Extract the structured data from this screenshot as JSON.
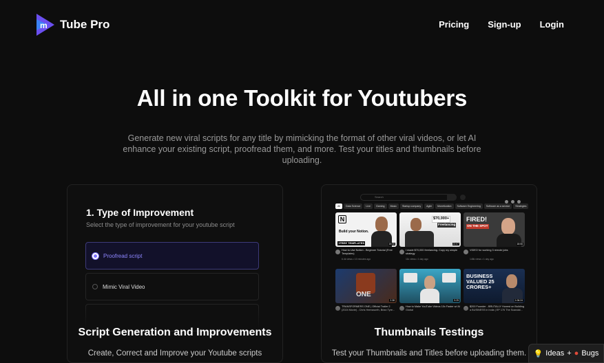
{
  "brand": {
    "name": "Tube Pro",
    "colors": {
      "logo_primary": "#6a4ff0",
      "logo_secondary": "#3b82f6"
    }
  },
  "nav": {
    "links": [
      "Pricing",
      "Sign-up",
      "Login"
    ]
  },
  "hero": {
    "title": "All in one Toolkit for Youtubers",
    "subtitle": "Generate new viral scripts for any title by mimicking the format of other viral videos, or let AI enhance your existing script, proofread them, and more. Test your titles and thumbnails before uploading."
  },
  "left_card": {
    "step_title": "1. Type of Improvement",
    "step_subtitle": "Select the type of improvement for your youtube script",
    "options": [
      {
        "label": "Proofread script",
        "selected": true
      },
      {
        "label": "Mimic Viral Video",
        "selected": false
      },
      {
        "label": "",
        "selected": false
      }
    ],
    "heading": "Script Generation and Improvements",
    "description": "Create, Correct and Improve your Youtube scripts"
  },
  "right_card": {
    "heading": "Thumbnails Testings",
    "description": "Test your Thumbnails and Titles before uploading them.",
    "yt": {
      "search_placeholder": "Search",
      "chips": [
        "All",
        "Data Science",
        "Live",
        "Gaming",
        "Music",
        "Startup company",
        "Agile",
        "Monetization",
        "Software Engineering",
        "Software as a service",
        "Strategies",
        "Ch"
      ],
      "videos": [
        {
          "title": "How to Use Notion - Beginner Tutorial (Free Templates)",
          "meta": "6.4k views • 10 minutes ago",
          "duration": "15:08",
          "thumb_text": "Build your Notion.",
          "thumb_badge": "+FREE TEMPLATES"
        },
        {
          "title": "I made $70,000 freelancing. Copy my simple strategy",
          "meta": "11k views • 1 day ago",
          "duration": "22:07",
          "thumb_text": "$70,000+",
          "thumb_badge": "Freelancing"
        },
        {
          "title": "VIDEO for working 3 remote jobs",
          "meta": "148k views • 1 day ago",
          "duration": "18:06",
          "thumb_text": "FIRED!",
          "thumb_badge": "ON THE SPOT"
        },
        {
          "title": "TRANSFORMERS ONE | Official Trailer 2 (2024 Movie) - Chris Hemsworth, Brian Tyre...",
          "meta": "",
          "duration": "2:38",
          "thumb_text": "ONE",
          "thumb_badge": ""
        },
        {
          "title": "How to Make YouTube Videos 10x Faster w/ AI Global",
          "meta": "",
          "duration": "5:25",
          "thumb_text": "",
          "thumb_badge": ""
        },
        {
          "title": "$200 Founder - BRUTALLY Honest on Building a BUSINESS in India | EP 176 The Scandal...",
          "meta": "",
          "duration": "1:06:24",
          "thumb_text": "BUSINESS VALUED 25 CRORES+",
          "thumb_badge": ""
        }
      ]
    }
  },
  "feedback_badge": {
    "ideas": "Ideas",
    "plus": "+",
    "bugs": "Bugs"
  }
}
